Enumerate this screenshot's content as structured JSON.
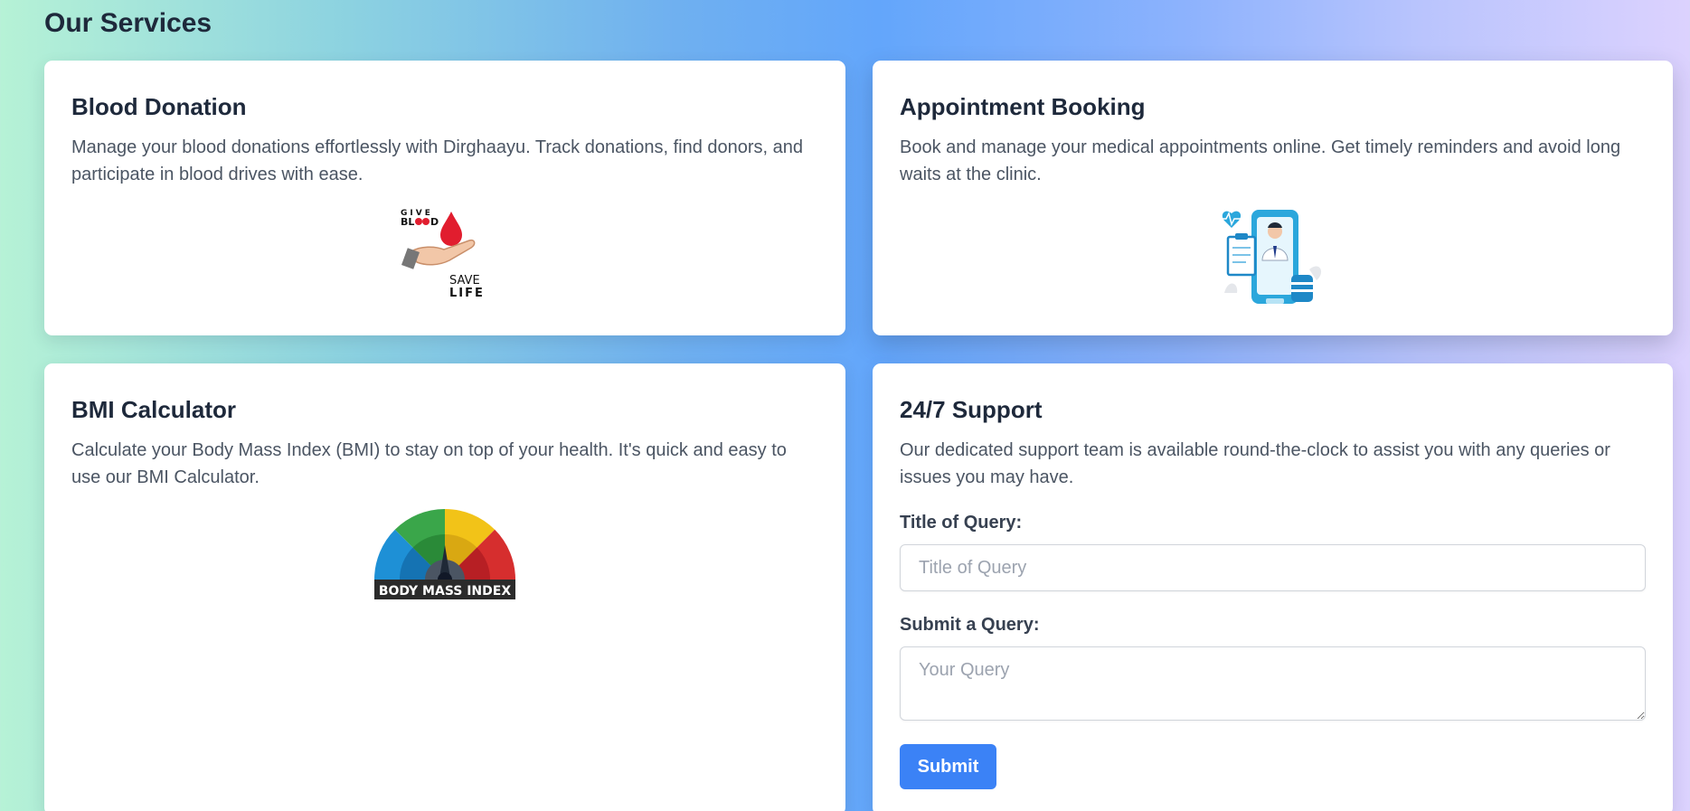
{
  "page": {
    "title": "Our Services"
  },
  "services": {
    "blood": {
      "title": "Blood Donation",
      "description": "Manage your blood donations effortlessly with Dirghaayu. Track donations, find donors, and participate in blood drives with ease.",
      "image_icon": "give-blood-save-life-icon"
    },
    "appointment": {
      "title": "Appointment Booking",
      "description": "Book and manage your medical appointments online. Get timely reminders and avoid long waits at the clinic.",
      "image_icon": "doctor-phone-appointment-icon"
    },
    "bmi": {
      "title": "BMI Calculator",
      "description": "Calculate your Body Mass Index (BMI) to stay on top of your health. It's quick and easy to use our BMI Calculator.",
      "image_icon": "bmi-gauge-icon",
      "gauge_caption": "BODY MASS INDEX"
    },
    "support": {
      "title": "24/7 Support",
      "description": "Our dedicated support team is available round-the-clock to assist you with any queries or issues you may have.",
      "query_title_label": "Title of Query:",
      "query_title_placeholder": "Title of Query",
      "query_body_label": "Submit a Query:",
      "query_body_placeholder": "Your Query",
      "submit_label": "Submit"
    }
  },
  "colors": {
    "accent": "#3b82f6",
    "heading": "#1e293b",
    "body_text": "#4b5563"
  }
}
